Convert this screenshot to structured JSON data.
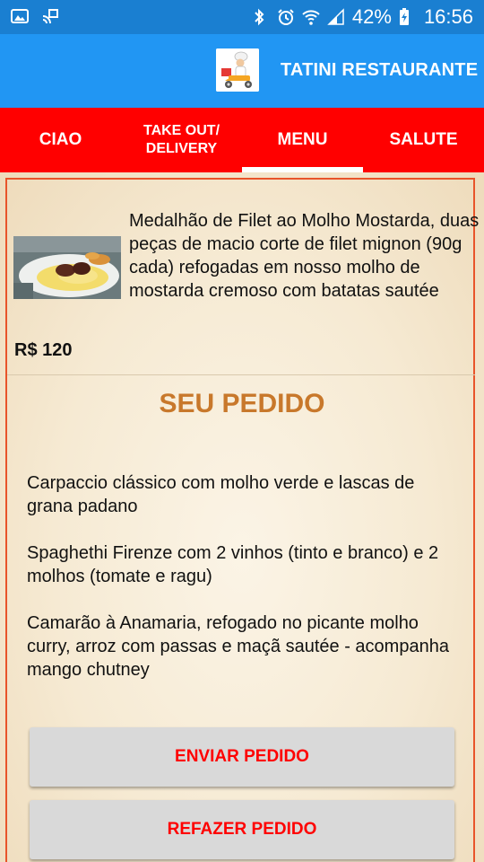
{
  "status_bar": {
    "battery_percent": "42%",
    "time": "16:56",
    "icons": [
      "gallery-icon",
      "cast-icon",
      "bluetooth-icon",
      "alarm-icon",
      "wifi-icon",
      "signal-icon",
      "battery-charging-icon"
    ]
  },
  "app_bar": {
    "title": "TATINI RESTAURANTE",
    "logo": "delivery-chef-scooter-logo"
  },
  "tabs": [
    {
      "label": "CIAO",
      "selected": false
    },
    {
      "label": "TAKE OUT/\nDELIVERY",
      "selected": false
    },
    {
      "label": "MENU",
      "selected": true
    },
    {
      "label": "SALUTE",
      "selected": false
    }
  ],
  "dish": {
    "description": "Medalhão de Filet ao Molho Mostarda, duas peças de macio corte de filet mignon (90g cada) refogadas em nosso molho de mostarda cremoso com batatas sautée",
    "price": "R$ 120"
  },
  "order": {
    "title": "SEU PEDIDO",
    "items": [
      "Carpaccio clássico com molho verde e lascas de grana padano",
      "Spaghethi Firenze com 2 vinhos (tinto e branco) e 2 molhos (tomate e ragu)",
      "Camarão à Anamaria, refogado no picante molho curry, arroz com passas e maçã sautée - acompanha mango chutney"
    ]
  },
  "buttons": {
    "send": "ENVIAR PEDIDO",
    "redo": "REFAZER PEDIDO"
  },
  "colors": {
    "status_bar": "#1a7fd1",
    "app_bar": "#2196f3",
    "tab_bar": "#ff0000",
    "section_title": "#c8782b",
    "frame_border": "#e8542a",
    "button_text": "#ff0000"
  }
}
